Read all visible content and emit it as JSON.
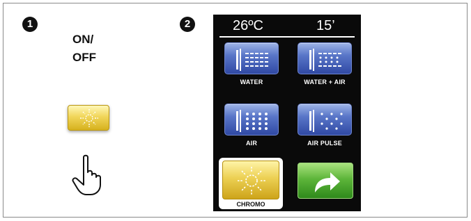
{
  "steps": {
    "step1": "1",
    "step2": "2"
  },
  "power": {
    "label_line1": "ON/",
    "label_line2": "OFF",
    "button_icon": "sun-icon",
    "cursor_icon": "pointing-hand-icon"
  },
  "panel": {
    "temperature": "26ºC",
    "duration": "15’",
    "modes": [
      {
        "label": "WATER",
        "icon": "bath-water-icon"
      },
      {
        "label": "WATER + AIR",
        "icon": "bath-water-air-icon"
      },
      {
        "label": "AIR",
        "icon": "bath-air-icon"
      },
      {
        "label": "AIR PULSE",
        "icon": "bath-air-pulse-icon"
      }
    ],
    "chromo_label": "CHROMO",
    "chromo_icon": "sun-icon",
    "next_icon": "curved-arrow-right-icon"
  },
  "colors": {
    "mode_button": "#3f5bb5",
    "chromo_button": "#e3c23c",
    "next_button": "#4ea82d",
    "panel_bg": "#0a0a0a"
  }
}
